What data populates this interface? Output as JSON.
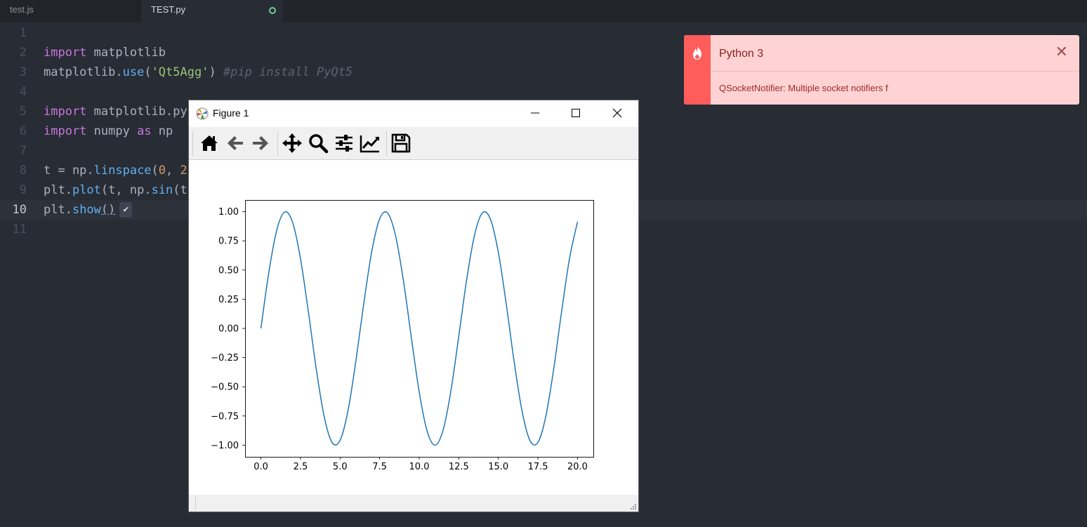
{
  "tabs": [
    {
      "label": "test.js",
      "active": false
    },
    {
      "label": "TEST.py",
      "active": true,
      "modified": true
    }
  ],
  "editor": {
    "line_numbers": [
      "1",
      "2",
      "3",
      "4",
      "5",
      "6",
      "7",
      "8",
      "9",
      "10",
      "11"
    ],
    "cursor_line": 10,
    "code": {
      "l2_kw": "import",
      "l2_rest": " matplotlib",
      "l3_a": "matplotlib.",
      "l3_fn": "use",
      "l3_b": "(",
      "l3_str": "'Qt5Agg'",
      "l3_c": ") ",
      "l3_cm": "#pip install PyQt5",
      "l5_kw": "import",
      "l5_rest": " matplotlib.py",
      "l6_kw": "import",
      "l6_a": " numpy ",
      "l6_kw2": "as",
      "l6_b": " np",
      "l8_a": "t = np.",
      "l8_fn": "linspace",
      "l8_b": "(",
      "l8_num": "0",
      "l8_c": ", ",
      "l8_num2": "2",
      "l9_a": "plt.",
      "l9_fn": "plot",
      "l9_b": "(t, np.",
      "l9_fn2": "sin",
      "l9_c": "(t",
      "l10_a": "plt.",
      "l10_fn": "show",
      "l10_b": "()",
      "check_glyph": "✔"
    }
  },
  "notification": {
    "title": "Python 3",
    "message": "QSocketNotifier: Multiple socket notifiers f",
    "close_glyph": "✕",
    "icon": "flame-icon",
    "color_bg": "#ffd3d3",
    "color_side": "#ff5c5c"
  },
  "figure_window": {
    "title": "Figure 1",
    "toolbar": [
      "home-icon",
      "back-icon",
      "forward-icon",
      "pan-icon",
      "zoom-icon",
      "configure-subplots-icon",
      "edit-axis-icon",
      "save-icon"
    ]
  },
  "chart_data": {
    "type": "line",
    "title": "",
    "xlabel": "",
    "ylabel": "",
    "xlim": [
      -1.0,
      21.0
    ],
    "ylim": [
      -1.1,
      1.1
    ],
    "xticks": [
      0.0,
      2.5,
      5.0,
      7.5,
      10.0,
      12.5,
      15.0,
      17.5,
      20.0
    ],
    "xtick_labels": [
      "0.0",
      "2.5",
      "5.0",
      "7.5",
      "10.0",
      "12.5",
      "15.0",
      "17.5",
      "20.0"
    ],
    "yticks": [
      1.0,
      0.75,
      0.5,
      0.25,
      0.0,
      -0.25,
      -0.5,
      -0.75,
      -1.0
    ],
    "ytick_labels": [
      "1.00",
      "0.75",
      "0.50",
      "0.25",
      "0.00",
      "−0.25",
      "−0.50",
      "−0.75",
      "−1.00"
    ],
    "series": [
      {
        "color": "#1f77b4",
        "x": [
          0,
          0.5,
          1,
          1.5,
          2,
          2.5,
          3,
          3.5,
          4,
          4.5,
          5,
          5.5,
          6,
          6.5,
          7,
          7.5,
          8,
          8.5,
          9,
          9.5,
          10,
          10.5,
          11,
          11.5,
          12,
          12.5,
          13,
          13.5,
          14,
          14.5,
          15,
          15.5,
          16,
          16.5,
          17,
          17.5,
          18,
          18.5,
          19,
          19.5,
          20
        ],
        "y": [
          0,
          0.479,
          0.841,
          0.997,
          0.909,
          0.598,
          0.141,
          -0.351,
          -0.757,
          -0.978,
          -0.959,
          -0.706,
          -0.279,
          0.215,
          0.657,
          0.938,
          0.989,
          0.798,
          0.412,
          -0.075,
          -0.544,
          -0.88,
          -1,
          -0.875,
          -0.537,
          -0.066,
          0.42,
          0.803,
          0.991,
          0.935,
          0.65,
          0.207,
          -0.288,
          -0.712,
          -0.961,
          -0.976,
          -0.751,
          -0.342,
          0.15,
          0.603,
          0.913
        ]
      }
    ],
    "grid": false,
    "legend": "none"
  }
}
